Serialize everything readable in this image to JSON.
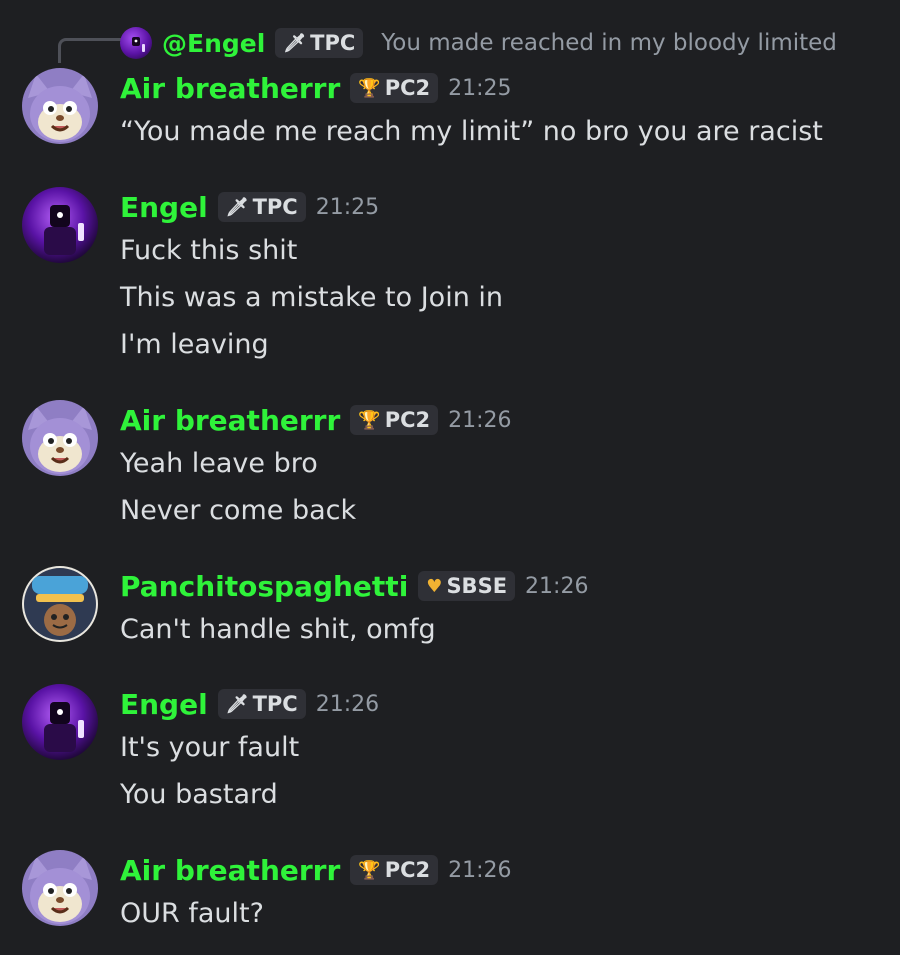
{
  "colors": {
    "background": "#1e1f22",
    "username": "#2ff33a",
    "text": "#dbdee1",
    "muted": "#949ba4",
    "tag_bg": "#2f3036"
  },
  "reply": {
    "name": "@Engel",
    "tag_icon": "dagger-icon",
    "tag": "TPC",
    "text": "You made reached in my bloody limited"
  },
  "messages": [
    {
      "user": "Air breatherrr",
      "tag_icon": "trophy-icon",
      "tag": "PC2",
      "time": "21:25",
      "lines": [
        "“You made me reach my limit” no bro you are racist"
      ]
    },
    {
      "user": "Engel",
      "tag_icon": "dagger-icon",
      "tag": "TPC",
      "time": "21:25",
      "lines": [
        "Fuck this shit",
        "This was a mistake to Join in",
        "I'm leaving"
      ]
    },
    {
      "user": "Air breatherrr",
      "tag_icon": "trophy-icon",
      "tag": "PC2",
      "time": "21:26",
      "lines": [
        "Yeah leave bro",
        "Never come back"
      ]
    },
    {
      "user": "Panchitospaghetti",
      "tag_icon": "heart-icon",
      "tag": "SBSE",
      "time": "21:26",
      "lines": [
        "Can't handle shit, omfg"
      ]
    },
    {
      "user": "Engel",
      "tag_icon": "dagger-icon",
      "tag": "TPC",
      "time": "21:26",
      "lines": [
        "It's your fault",
        "You bastard"
      ]
    },
    {
      "user": "Air breatherrr",
      "tag_icon": "trophy-icon",
      "tag": "PC2",
      "time": "21:26",
      "lines": [
        "OUR fault?"
      ]
    }
  ]
}
